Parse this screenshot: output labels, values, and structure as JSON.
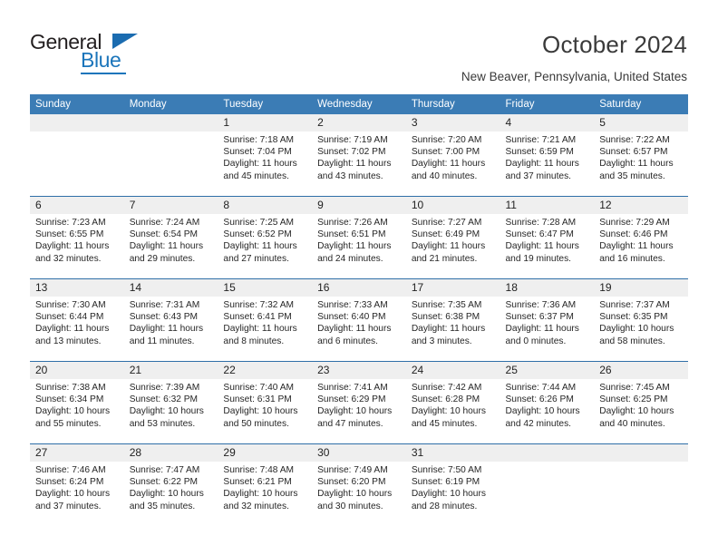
{
  "brand": {
    "name_top": "General",
    "name_bottom": "Blue"
  },
  "header": {
    "title": "October 2024",
    "subtitle": "New Beaver, Pennsylvania, United States"
  },
  "theme": {
    "header_blue": "#3b7cb5",
    "rule_blue": "#2f6fa8",
    "daynum_band": "#efefef",
    "logo_blue": "#1b75bb"
  },
  "weekdays": [
    "Sunday",
    "Monday",
    "Tuesday",
    "Wednesday",
    "Thursday",
    "Friday",
    "Saturday"
  ],
  "labels": {
    "sunrise": "Sunrise:",
    "sunset": "Sunset:",
    "daylight": "Daylight:"
  },
  "weeks": [
    [
      {
        "day": "",
        "sunrise": "",
        "sunset": "",
        "daylight_1": "",
        "daylight_2": ""
      },
      {
        "day": "",
        "sunrise": "",
        "sunset": "",
        "daylight_1": "",
        "daylight_2": ""
      },
      {
        "day": "1",
        "sunrise": "Sunrise: 7:18 AM",
        "sunset": "Sunset: 7:04 PM",
        "daylight_1": "Daylight: 11 hours",
        "daylight_2": "and 45 minutes."
      },
      {
        "day": "2",
        "sunrise": "Sunrise: 7:19 AM",
        "sunset": "Sunset: 7:02 PM",
        "daylight_1": "Daylight: 11 hours",
        "daylight_2": "and 43 minutes."
      },
      {
        "day": "3",
        "sunrise": "Sunrise: 7:20 AM",
        "sunset": "Sunset: 7:00 PM",
        "daylight_1": "Daylight: 11 hours",
        "daylight_2": "and 40 minutes."
      },
      {
        "day": "4",
        "sunrise": "Sunrise: 7:21 AM",
        "sunset": "Sunset: 6:59 PM",
        "daylight_1": "Daylight: 11 hours",
        "daylight_2": "and 37 minutes."
      },
      {
        "day": "5",
        "sunrise": "Sunrise: 7:22 AM",
        "sunset": "Sunset: 6:57 PM",
        "daylight_1": "Daylight: 11 hours",
        "daylight_2": "and 35 minutes."
      }
    ],
    [
      {
        "day": "6",
        "sunrise": "Sunrise: 7:23 AM",
        "sunset": "Sunset: 6:55 PM",
        "daylight_1": "Daylight: 11 hours",
        "daylight_2": "and 32 minutes."
      },
      {
        "day": "7",
        "sunrise": "Sunrise: 7:24 AM",
        "sunset": "Sunset: 6:54 PM",
        "daylight_1": "Daylight: 11 hours",
        "daylight_2": "and 29 minutes."
      },
      {
        "day": "8",
        "sunrise": "Sunrise: 7:25 AM",
        "sunset": "Sunset: 6:52 PM",
        "daylight_1": "Daylight: 11 hours",
        "daylight_2": "and 27 minutes."
      },
      {
        "day": "9",
        "sunrise": "Sunrise: 7:26 AM",
        "sunset": "Sunset: 6:51 PM",
        "daylight_1": "Daylight: 11 hours",
        "daylight_2": "and 24 minutes."
      },
      {
        "day": "10",
        "sunrise": "Sunrise: 7:27 AM",
        "sunset": "Sunset: 6:49 PM",
        "daylight_1": "Daylight: 11 hours",
        "daylight_2": "and 21 minutes."
      },
      {
        "day": "11",
        "sunrise": "Sunrise: 7:28 AM",
        "sunset": "Sunset: 6:47 PM",
        "daylight_1": "Daylight: 11 hours",
        "daylight_2": "and 19 minutes."
      },
      {
        "day": "12",
        "sunrise": "Sunrise: 7:29 AM",
        "sunset": "Sunset: 6:46 PM",
        "daylight_1": "Daylight: 11 hours",
        "daylight_2": "and 16 minutes."
      }
    ],
    [
      {
        "day": "13",
        "sunrise": "Sunrise: 7:30 AM",
        "sunset": "Sunset: 6:44 PM",
        "daylight_1": "Daylight: 11 hours",
        "daylight_2": "and 13 minutes."
      },
      {
        "day": "14",
        "sunrise": "Sunrise: 7:31 AM",
        "sunset": "Sunset: 6:43 PM",
        "daylight_1": "Daylight: 11 hours",
        "daylight_2": "and 11 minutes."
      },
      {
        "day": "15",
        "sunrise": "Sunrise: 7:32 AM",
        "sunset": "Sunset: 6:41 PM",
        "daylight_1": "Daylight: 11 hours",
        "daylight_2": "and 8 minutes."
      },
      {
        "day": "16",
        "sunrise": "Sunrise: 7:33 AM",
        "sunset": "Sunset: 6:40 PM",
        "daylight_1": "Daylight: 11 hours",
        "daylight_2": "and 6 minutes."
      },
      {
        "day": "17",
        "sunrise": "Sunrise: 7:35 AM",
        "sunset": "Sunset: 6:38 PM",
        "daylight_1": "Daylight: 11 hours",
        "daylight_2": "and 3 minutes."
      },
      {
        "day": "18",
        "sunrise": "Sunrise: 7:36 AM",
        "sunset": "Sunset: 6:37 PM",
        "daylight_1": "Daylight: 11 hours",
        "daylight_2": "and 0 minutes."
      },
      {
        "day": "19",
        "sunrise": "Sunrise: 7:37 AM",
        "sunset": "Sunset: 6:35 PM",
        "daylight_1": "Daylight: 10 hours",
        "daylight_2": "and 58 minutes."
      }
    ],
    [
      {
        "day": "20",
        "sunrise": "Sunrise: 7:38 AM",
        "sunset": "Sunset: 6:34 PM",
        "daylight_1": "Daylight: 10 hours",
        "daylight_2": "and 55 minutes."
      },
      {
        "day": "21",
        "sunrise": "Sunrise: 7:39 AM",
        "sunset": "Sunset: 6:32 PM",
        "daylight_1": "Daylight: 10 hours",
        "daylight_2": "and 53 minutes."
      },
      {
        "day": "22",
        "sunrise": "Sunrise: 7:40 AM",
        "sunset": "Sunset: 6:31 PM",
        "daylight_1": "Daylight: 10 hours",
        "daylight_2": "and 50 minutes."
      },
      {
        "day": "23",
        "sunrise": "Sunrise: 7:41 AM",
        "sunset": "Sunset: 6:29 PM",
        "daylight_1": "Daylight: 10 hours",
        "daylight_2": "and 47 minutes."
      },
      {
        "day": "24",
        "sunrise": "Sunrise: 7:42 AM",
        "sunset": "Sunset: 6:28 PM",
        "daylight_1": "Daylight: 10 hours",
        "daylight_2": "and 45 minutes."
      },
      {
        "day": "25",
        "sunrise": "Sunrise: 7:44 AM",
        "sunset": "Sunset: 6:26 PM",
        "daylight_1": "Daylight: 10 hours",
        "daylight_2": "and 42 minutes."
      },
      {
        "day": "26",
        "sunrise": "Sunrise: 7:45 AM",
        "sunset": "Sunset: 6:25 PM",
        "daylight_1": "Daylight: 10 hours",
        "daylight_2": "and 40 minutes."
      }
    ],
    [
      {
        "day": "27",
        "sunrise": "Sunrise: 7:46 AM",
        "sunset": "Sunset: 6:24 PM",
        "daylight_1": "Daylight: 10 hours",
        "daylight_2": "and 37 minutes."
      },
      {
        "day": "28",
        "sunrise": "Sunrise: 7:47 AM",
        "sunset": "Sunset: 6:22 PM",
        "daylight_1": "Daylight: 10 hours",
        "daylight_2": "and 35 minutes."
      },
      {
        "day": "29",
        "sunrise": "Sunrise: 7:48 AM",
        "sunset": "Sunset: 6:21 PM",
        "daylight_1": "Daylight: 10 hours",
        "daylight_2": "and 32 minutes."
      },
      {
        "day": "30",
        "sunrise": "Sunrise: 7:49 AM",
        "sunset": "Sunset: 6:20 PM",
        "daylight_1": "Daylight: 10 hours",
        "daylight_2": "and 30 minutes."
      },
      {
        "day": "31",
        "sunrise": "Sunrise: 7:50 AM",
        "sunset": "Sunset: 6:19 PM",
        "daylight_1": "Daylight: 10 hours",
        "daylight_2": "and 28 minutes."
      },
      {
        "day": "",
        "sunrise": "",
        "sunset": "",
        "daylight_1": "",
        "daylight_2": ""
      },
      {
        "day": "",
        "sunrise": "",
        "sunset": "",
        "daylight_1": "",
        "daylight_2": ""
      }
    ]
  ]
}
